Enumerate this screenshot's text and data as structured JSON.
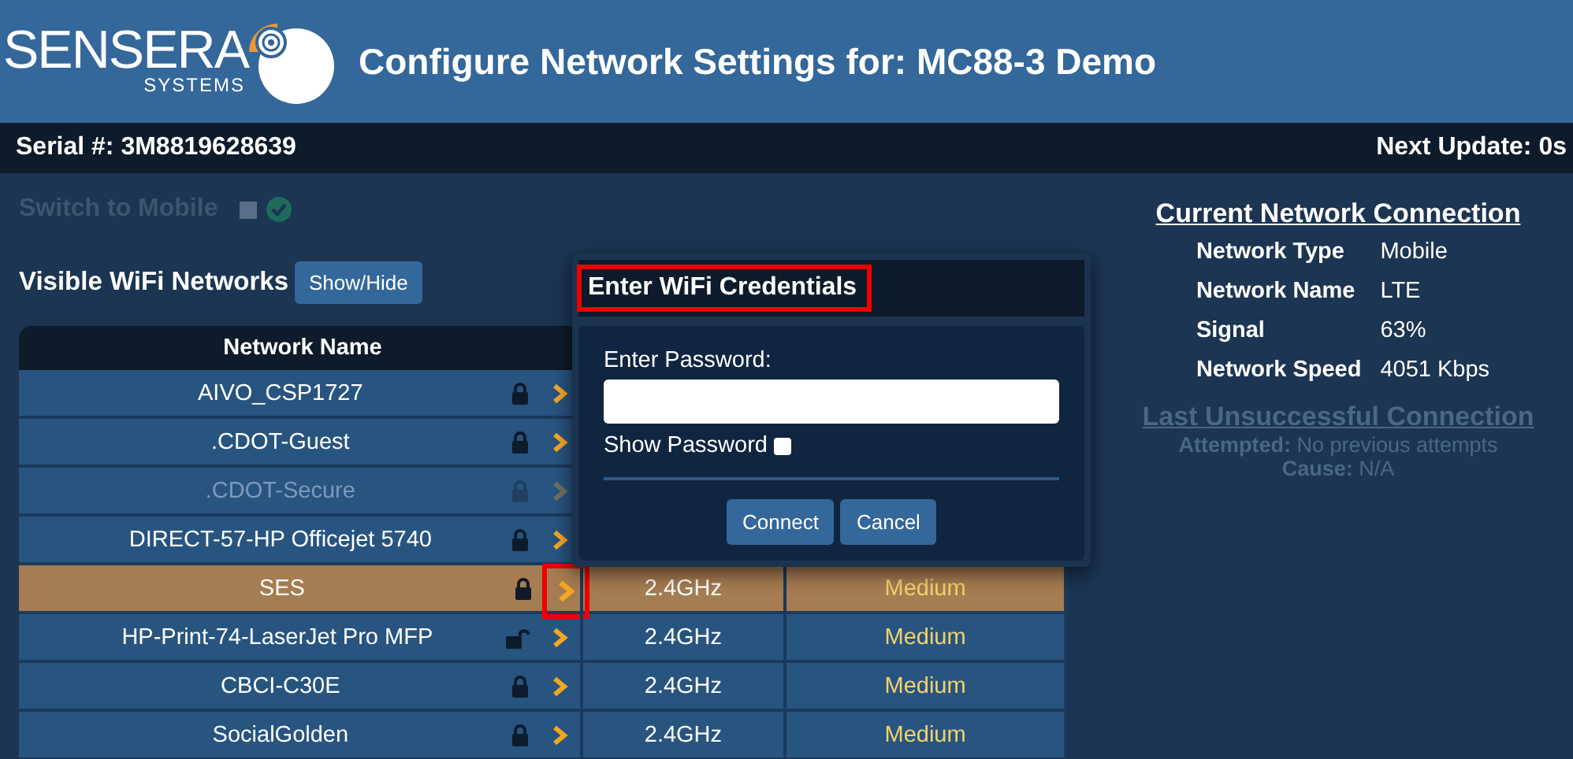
{
  "header": {
    "logo_text": "SENSERA",
    "logo_subtext": "SYSTEMS",
    "title": "Configure Network Settings for: MC88-3 Demo"
  },
  "info_bar": {
    "serial": "Serial #: 3M8819628639",
    "next_update": "Next Update: 0s"
  },
  "switch_to_mobile": {
    "label": "Switch to Mobile",
    "disabled": true,
    "checked": false
  },
  "wifi": {
    "title": "Visible WiFi Networks",
    "toggle_button": "Show/Hide",
    "columns": [
      "Network Name"
    ],
    "rows": [
      {
        "name": "AIVO_CSP1727",
        "locked": true,
        "disabled": false,
        "selected": false,
        "highlighted": false
      },
      {
        "name": ".CDOT-Guest",
        "locked": true,
        "disabled": false,
        "selected": false,
        "highlighted": false
      },
      {
        "name": ".CDOT-Secure",
        "locked": true,
        "disabled": true,
        "selected": false,
        "highlighted": false
      },
      {
        "name": "DIRECT-57-HP Officejet 5740",
        "locked": true,
        "disabled": false,
        "selected": false,
        "highlighted": false
      },
      {
        "name": "SES",
        "locked": true,
        "disabled": false,
        "selected": true,
        "highlighted": true,
        "band": "2.4GHz",
        "strength": "Medium"
      },
      {
        "name": "HP-Print-74-LaserJet Pro MFP",
        "locked": false,
        "disabled": false,
        "selected": false,
        "highlighted": false,
        "band": "2.4GHz",
        "strength": "Medium"
      },
      {
        "name": "CBCI-C30E",
        "locked": true,
        "disabled": false,
        "selected": false,
        "highlighted": false,
        "band": "2.4GHz",
        "strength": "Medium"
      },
      {
        "name": "SocialGolden",
        "locked": true,
        "disabled": false,
        "selected": false,
        "highlighted": false,
        "band": "2.4GHz",
        "strength": "Medium"
      }
    ]
  },
  "modal": {
    "title": "Enter WiFi Credentials",
    "title_highlighted": true,
    "password_label": "Enter Password:",
    "show_password_label": "Show Password",
    "show_password_checked": false,
    "buttons": [
      "Connect",
      "Cancel"
    ]
  },
  "current_connection": {
    "title": "Current Network Connection",
    "fields": [
      {
        "label": "Network Type",
        "value": "Mobile"
      },
      {
        "label": "Network Name",
        "value": "LTE"
      },
      {
        "label": "Signal",
        "value": "63%"
      },
      {
        "label": "Network Speed",
        "value": "4051 Kbps"
      }
    ]
  },
  "last_unsuccessful": {
    "title": "Last Unsuccessful Connection",
    "lines": [
      {
        "label": "Attempted:",
        "value": "No previous attempts"
      },
      {
        "label": "Cause:",
        "value": "N/A"
      }
    ]
  }
}
